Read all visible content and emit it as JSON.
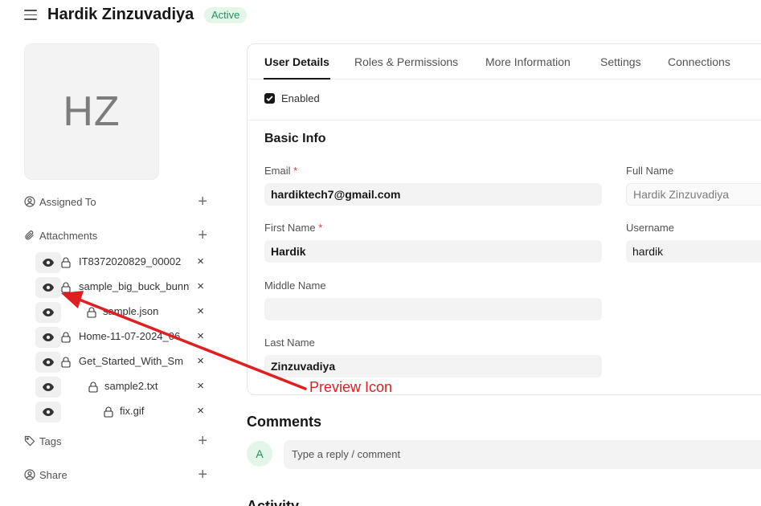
{
  "header": {
    "title": "Hardik Zinzuvadiya",
    "status": "Active"
  },
  "sidebar": {
    "avatar_initials": "HZ",
    "assigned_to": "Assigned To",
    "attachments_label": "Attachments",
    "attachments": [
      {
        "name": "IT8372020829_00002"
      },
      {
        "name": "sample_big_buck_bunny"
      },
      {
        "name": "sample.json"
      },
      {
        "name": "Home-11-07-2024_06"
      },
      {
        "name": "Get_Started_With_Sm"
      },
      {
        "name": "sample2.txt"
      },
      {
        "name": "fix.gif"
      }
    ],
    "tags": "Tags",
    "share": "Share",
    "plus": "+",
    "close": "×"
  },
  "tabs": [
    {
      "label": "User Details",
      "active": true
    },
    {
      "label": "Roles & Permissions"
    },
    {
      "label": "More Information"
    },
    {
      "label": "Settings"
    },
    {
      "label": "Connections"
    }
  ],
  "form": {
    "enabled_label": "Enabled",
    "enabled": true,
    "section_title": "Basic Info",
    "email_label": "Email",
    "email_value": "hardiktech7@gmail.com",
    "full_name_label": "Full Name",
    "full_name_value": "Hardik Zinzuvadiya",
    "first_name_label": "First Name",
    "first_name_value": "Hardik",
    "username_label": "Username",
    "username_value": "hardik",
    "middle_name_label": "Middle Name",
    "middle_name_value": "",
    "last_name_label": "Last Name",
    "last_name_value": "Zinzuvadiya",
    "required_mark": "*"
  },
  "comments": {
    "title": "Comments",
    "avatar_initial": "A",
    "placeholder": "Type a reply / comment"
  },
  "activity": {
    "title": "Activity"
  },
  "annotation": {
    "label": "Preview Icon",
    "color": "#e02020"
  },
  "colors": {
    "active_badge_bg": "#e4f5e9",
    "active_badge_text": "#278f5e"
  }
}
